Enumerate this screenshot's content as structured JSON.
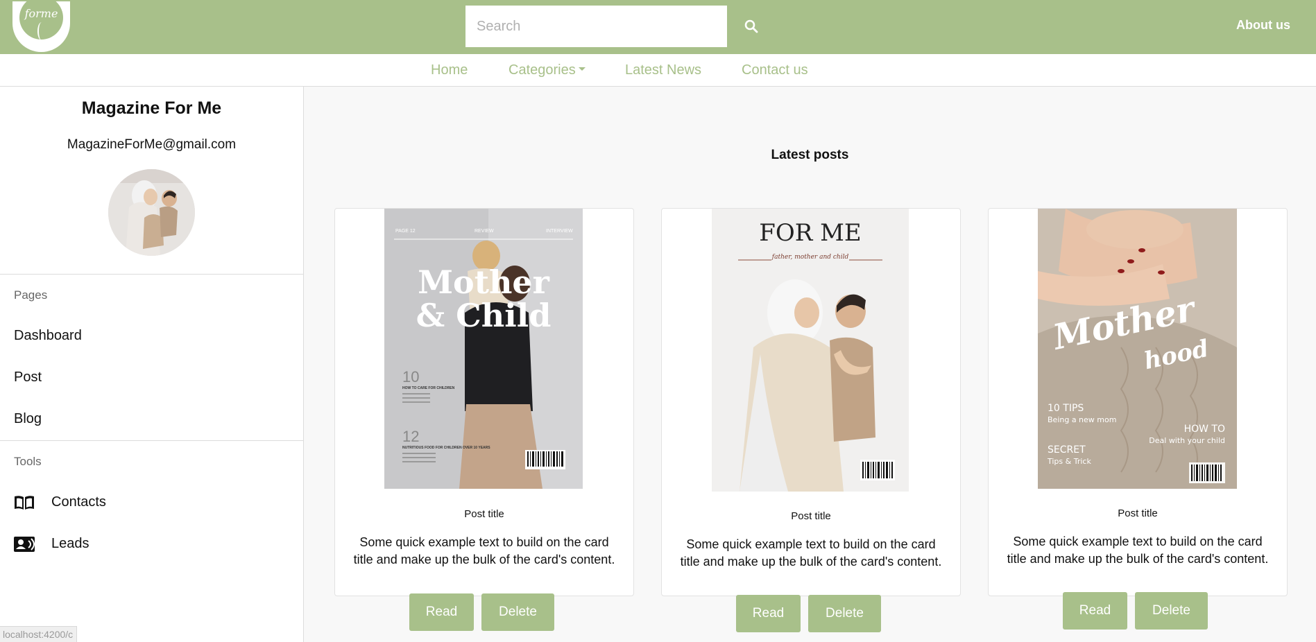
{
  "header": {
    "logo_text": "forme",
    "search_placeholder": "Search",
    "about_label": "About us"
  },
  "nav": {
    "home": "Home",
    "categories": "Categories",
    "latest_news": "Latest News",
    "contact": "Contact us"
  },
  "sidebar": {
    "site_name": "Magazine For Me",
    "email": "MagazineForMe@gmail.com",
    "pages_label": "Pages",
    "pages": [
      "Dashboard",
      "Post",
      "Blog"
    ],
    "tools_label": "Tools",
    "tools": [
      {
        "label": "Contacts",
        "icon": "book-open-icon"
      },
      {
        "label": "Leads",
        "icon": "contact-card-icon"
      }
    ]
  },
  "main": {
    "heading": "Latest posts",
    "cards": [
      {
        "cover": {
          "top": [
            "PAGE 12",
            "REVIEW",
            "INTERVIEW"
          ],
          "title_line1": "Mother",
          "title_line2": "& Child",
          "num1": "10",
          "sub1": "HOW TO CARE FOR CHILDREN",
          "num2": "12",
          "sub2": "NUTRITIOUS FOOD FOR CHILDREN OVER 10 YEARS"
        },
        "title": "Post title",
        "text": "Some quick example text to build on the card title and make up the bulk of the card's content.",
        "read": "Read",
        "delete": "Delete"
      },
      {
        "cover": {
          "title": "FOR ME",
          "subtitle": "father, mother and child"
        },
        "title": "Post title",
        "text": "Some quick example text to build on the card title and make up the bulk of the card's content.",
        "read": "Read",
        "delete": "Delete"
      },
      {
        "cover": {
          "title_line1": "Mother",
          "title_line2": "hood",
          "tips_title": "10 TIPS",
          "tips_sub": "Being a new mom",
          "secret_title": "SECRET",
          "secret_sub": "Tips & Trick",
          "howto_title": "HOW TO",
          "howto_sub": "Deal with your child"
        },
        "title": "Post title",
        "text": "Some quick example text to build on the card title and make up the bulk of the card's content.",
        "read": "Read",
        "delete": "Delete"
      }
    ]
  },
  "status_url": "localhost:4200/c",
  "colors": {
    "accent": "#a8c08a",
    "background": "#f8f8f8"
  }
}
